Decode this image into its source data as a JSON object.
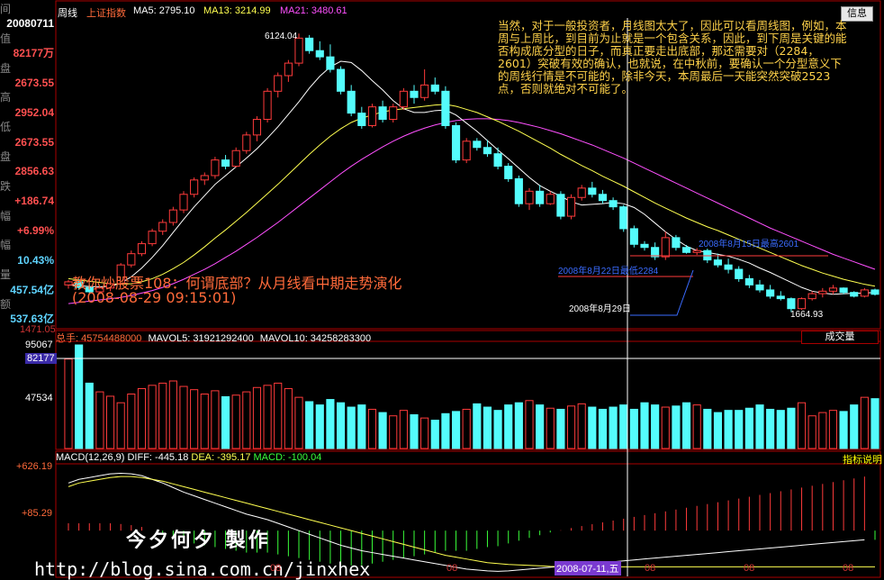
{
  "left_panel": [
    {
      "label": "间",
      "value": "",
      "color": "#ffffff"
    },
    {
      "label": "",
      "value": "20080711",
      "color": "#ffffff"
    },
    {
      "label": "值",
      "value": "",
      "color": "#ffffff"
    },
    {
      "label": "",
      "value": "82177万",
      "color": "#ff5050"
    },
    {
      "label": "盘",
      "value": "",
      "color": "#ffffff"
    },
    {
      "label": "",
      "value": "2673.55",
      "color": "#ff5050"
    },
    {
      "label": "高",
      "value": "",
      "color": "#ffffff"
    },
    {
      "label": "",
      "value": "2952.04",
      "color": "#ff5050"
    },
    {
      "label": "低",
      "value": "",
      "color": "#ffffff"
    },
    {
      "label": "",
      "value": "2673.55",
      "color": "#ff5050"
    },
    {
      "label": "盘",
      "value": "",
      "color": "#ffffff"
    },
    {
      "label": "",
      "value": "2856.63",
      "color": "#ff5050"
    },
    {
      "label": "跌",
      "value": "",
      "color": "#ffffff"
    },
    {
      "label": "",
      "value": "+186.74",
      "color": "#ff5050"
    },
    {
      "label": "幅",
      "value": "",
      "color": "#ffffff"
    },
    {
      "label": "",
      "value": "+6.99%",
      "color": "#ff5050"
    },
    {
      "label": "幅",
      "value": "",
      "color": "#ffffff"
    },
    {
      "label": "",
      "value": "10.43%",
      "color": "#5fd4ff"
    },
    {
      "label": "量",
      "value": "",
      "color": "#ffffff"
    },
    {
      "label": "",
      "value": "457.54亿",
      "color": "#5fd4ff"
    },
    {
      "label": "额",
      "value": "",
      "color": "#ffffff"
    },
    {
      "label": "",
      "value": "537.63亿",
      "color": "#5fd4ff"
    }
  ],
  "header": {
    "period": "周线",
    "index_name": "上证指数",
    "ma5": "MA5: 2795.10",
    "ma13": "MA13: 3214.99",
    "ma21": "MA21: 3480.61",
    "info_button": "信息"
  },
  "comment": "当然，对于一般投资者，月线图太大了，因此可以看周线图，例如，本周与上周比，到目前为止就是一个包含关系，因此，到下周是关键的能否构成底分型的日子，而真正要走出底部，那还需要对（2284，2601）突破有效的确认，也就说，在中秋前，要确认一个分型意义下的周线行情是不可能的，除非今天，本周最后一天能突然突破2523点，否则就绝对不可能了。",
  "overlay": {
    "title": "教你炒股票108：何谓底部？从月线看中期走势演化",
    "time": "(2008-08-29 09:15:01)"
  },
  "annotations": {
    "peak": "6124.04",
    "low": "1664.93",
    "a1": "2008年8月15日最高2601",
    "a2": "2008年8月22日最低2284",
    "a3": "2008年8月29日"
  },
  "main_axis": {
    "bottom_label": "1471.05"
  },
  "volume": {
    "header_label": "总手:",
    "header_value": "45754488000",
    "mavol5": "MAVOL5: 31921292400",
    "mavol10": "MAVOL10: 34258283300",
    "select": "成交量",
    "y_top": "95067",
    "y_highlight": "82177",
    "y_mid": "47534"
  },
  "macd": {
    "label": "MACD(12,26,9)",
    "diff": "DIFF: -445.18",
    "dea": "DEA: -395.17",
    "macd": "MACD: -100.04",
    "button": "指标说明",
    "y_top": "+626.19",
    "y_mid": "+85.29"
  },
  "x_axis": {
    "labels": [
      "08",
      "08",
      "08",
      "08",
      "08"
    ],
    "selected": "2008-07-11,五"
  },
  "watermark": "今夕何夕  製作",
  "url": "http://blog.sina.com.cn/jinxhex",
  "colors": {
    "up": "#ff3b3b",
    "down": "#54fcfc",
    "ma5": "#ffffff",
    "ma13": "#ffff50",
    "ma21": "#ff50ff",
    "bg": "#000000"
  },
  "chart_data": {
    "type": "candlestick",
    "title": "上证指数 周线",
    "ylim": [
      1471.05,
      6300
    ],
    "candles": [
      [
        2100,
        2180,
        2040,
        2150
      ],
      [
        2150,
        2190,
        2020,
        2060
      ],
      [
        2060,
        2100,
        1960,
        1990
      ],
      [
        1990,
        2080,
        1950,
        2050
      ],
      [
        2050,
        2150,
        2000,
        2120
      ],
      [
        2120,
        2450,
        2100,
        2420
      ],
      [
        2420,
        2650,
        2380,
        2600
      ],
      [
        2600,
        2800,
        2560,
        2760
      ],
      [
        2760,
        3000,
        2720,
        2960
      ],
      [
        2960,
        3150,
        2900,
        3100
      ],
      [
        3100,
        3350,
        3050,
        3300
      ],
      [
        3300,
        3600,
        3250,
        3550
      ],
      [
        3550,
        3820,
        3500,
        3780
      ],
      [
        3780,
        3900,
        3700,
        3850
      ],
      [
        3850,
        4150,
        3800,
        4100
      ],
      [
        4100,
        4180,
        3950,
        4000
      ],
      [
        4000,
        4300,
        3980,
        4250
      ],
      [
        4250,
        4550,
        4200,
        4500
      ],
      [
        4500,
        4800,
        4400,
        4750
      ],
      [
        4750,
        5250,
        4700,
        5200
      ],
      [
        5200,
        5500,
        5100,
        5450
      ],
      [
        5450,
        5700,
        5350,
        5650
      ],
      [
        5650,
        6124.04,
        5600,
        6050
      ],
      [
        6050,
        6100,
        5800,
        5850
      ],
      [
        5850,
        6000,
        5700,
        5750
      ],
      [
        5750,
        5950,
        5500,
        5550
      ],
      [
        5550,
        5600,
        5150,
        5200
      ],
      [
        5200,
        5300,
        4800,
        4850
      ],
      [
        4850,
        4950,
        4600,
        4650
      ],
      [
        4650,
        5000,
        4620,
        4950
      ],
      [
        4950,
        5050,
        4700,
        4750
      ],
      [
        4750,
        5000,
        4700,
        4950
      ],
      [
        4950,
        5250,
        4900,
        5200
      ],
      [
        5200,
        5300,
        5000,
        5100
      ],
      [
        5100,
        5550,
        5050,
        5300
      ],
      [
        5300,
        5420,
        5150,
        5200
      ],
      [
        5200,
        5280,
        4600,
        4650
      ],
      [
        4650,
        4700,
        4050,
        4100
      ],
      [
        4100,
        4450,
        4050,
        4400
      ],
      [
        4400,
        4450,
        4250,
        4300
      ],
      [
        4300,
        4420,
        4150,
        4200
      ],
      [
        4200,
        4300,
        3950,
        4000
      ],
      [
        4000,
        4050,
        3750,
        3800
      ],
      [
        3800,
        3850,
        3350,
        3400
      ],
      [
        3400,
        3650,
        3300,
        3600
      ],
      [
        3600,
        3700,
        3350,
        3400
      ],
      [
        3400,
        3600,
        3380,
        3550
      ],
      [
        3550,
        3600,
        3150,
        3200
      ],
      [
        3200,
        3550,
        3150,
        3500
      ],
      [
        3500,
        3700,
        3450,
        3650
      ],
      [
        3650,
        3750,
        3500,
        3550
      ],
      [
        3550,
        3620,
        3400,
        3450
      ],
      [
        3450,
        3500,
        3300,
        3350
      ],
      [
        3350,
        3380,
        2950,
        3000
      ],
      [
        3000,
        3050,
        2700,
        2750
      ],
      [
        2750,
        2800,
        2650,
        2700
      ],
      [
        2700,
        2780,
        2500,
        2550
      ],
      [
        2550,
        2952.04,
        2500,
        2856.63
      ],
      [
        2856.63,
        2900,
        2650,
        2700
      ],
      [
        2700,
        2740,
        2600,
        2620
      ],
      [
        2620,
        2690,
        2580,
        2650
      ],
      [
        2650,
        2680,
        2450,
        2500
      ],
      [
        2500,
        2601,
        2380,
        2420
      ],
      [
        2420,
        2520,
        2284,
        2350
      ],
      [
        2350,
        2400,
        2150,
        2200
      ],
      [
        2200,
        2260,
        2050,
        2100
      ],
      [
        2100,
        2180,
        1980,
        2020
      ],
      [
        2020,
        2100,
        1880,
        1920
      ],
      [
        1920,
        2000,
        1850,
        1880
      ],
      [
        1880,
        1900,
        1664.93,
        1720
      ],
      [
        1720,
        1900,
        1700,
        1880
      ],
      [
        1880,
        2000,
        1850,
        1960
      ],
      [
        1960,
        2050,
        1900,
        2000
      ],
      [
        2000,
        2100,
        1950,
        2050
      ],
      [
        2050,
        2060,
        1950,
        1980
      ],
      [
        1980,
        2000,
        1900,
        1920
      ],
      [
        1920,
        2050,
        1900,
        2020
      ],
      [
        2020,
        2040,
        1930,
        1950
      ]
    ],
    "ma5": [
      2100,
      2090,
      2075,
      2070,
      2075,
      2130,
      2230,
      2370,
      2540,
      2730,
      2940,
      3150,
      3350,
      3530,
      3710,
      3850,
      3990,
      4130,
      4280,
      4450,
      4630,
      4830,
      5030,
      5250,
      5440,
      5590,
      5680,
      5660,
      5530,
      5370,
      5220,
      5050,
      4920,
      4860,
      4860,
      4890,
      4900,
      4820,
      4690,
      4560,
      4410,
      4260,
      4120,
      3970,
      3820,
      3690,
      3600,
      3520,
      3430,
      3380,
      3390,
      3400,
      3420,
      3400,
      3340,
      3230,
      3090,
      2950,
      2830,
      2720,
      2650,
      2620,
      2590,
      2560,
      2510,
      2450,
      2370,
      2300,
      2220,
      2140,
      2060,
      2000,
      1970,
      1950,
      1960,
      1965,
      1970,
      1980
    ],
    "ma13": [
      2200,
      2180,
      2160,
      2140,
      2120,
      2110,
      2120,
      2150,
      2200,
      2270,
      2360,
      2460,
      2580,
      2710,
      2850,
      2980,
      3120,
      3260,
      3410,
      3560,
      3710,
      3870,
      4030,
      4190,
      4340,
      4480,
      4600,
      4700,
      4770,
      4820,
      4870,
      4900,
      4920,
      4940,
      4960,
      4980,
      4990,
      4960,
      4910,
      4860,
      4790,
      4720,
      4640,
      4560,
      4470,
      4380,
      4290,
      4190,
      4100,
      4010,
      3930,
      3840,
      3760,
      3680,
      3590,
      3500,
      3410,
      3330,
      3250,
      3170,
      3100,
      3030,
      2970,
      2900,
      2830,
      2760,
      2690,
      2620,
      2550,
      2480,
      2410,
      2350,
      2290,
      2240,
      2190,
      2150,
      2110,
      2080
    ],
    "ma21": [
      1800,
      1820,
      1840,
      1860,
      1880,
      1900,
      1930,
      1970,
      2010,
      2060,
      2120,
      2190,
      2270,
      2350,
      2440,
      2540,
      2640,
      2750,
      2860,
      2980,
      3100,
      3230,
      3360,
      3490,
      3620,
      3750,
      3880,
      4000,
      4110,
      4210,
      4310,
      4400,
      4480,
      4550,
      4610,
      4660,
      4700,
      4730,
      4750,
      4760,
      4760,
      4750,
      4730,
      4700,
      4660,
      4620,
      4570,
      4520,
      4460,
      4400,
      4340,
      4270,
      4200,
      4130,
      4050,
      3970,
      3890,
      3810,
      3730,
      3650,
      3570,
      3490,
      3410,
      3330,
      3250,
      3170,
      3090,
      3010,
      2940,
      2870,
      2800,
      2730,
      2660,
      2590,
      2530,
      2470,
      2410,
      2350
    ],
    "volume": {
      "ylim": [
        0,
        95067
      ],
      "values": [
        82177,
        95067,
        60000,
        52000,
        48000,
        42000,
        50000,
        55000,
        58000,
        60000,
        62000,
        57000,
        54000,
        50000,
        53000,
        47534,
        49000,
        52000,
        56000,
        58000,
        60000,
        55000,
        47000,
        43000,
        40000,
        45000,
        42000,
        38000,
        40000,
        36000,
        33000,
        30000,
        35000,
        31000,
        28000,
        26000,
        32000,
        34000,
        36000,
        41000,
        38000,
        35000,
        40000,
        42000,
        44000,
        40000,
        37000,
        36000,
        39000,
        41000,
        38000,
        36000,
        38000,
        40000,
        36000,
        42000,
        40000,
        38000,
        39000,
        42000,
        40000,
        36000,
        33000,
        35000,
        35000,
        37000,
        40000,
        36000,
        35000,
        37000,
        42000,
        30000,
        33000,
        35000,
        34000,
        40000,
        47000,
        45754
      ]
    },
    "macd": {
      "ylim": [
        -500,
        700
      ],
      "diff": [
        520,
        560,
        580,
        600,
        620,
        626.19,
        620,
        600,
        560,
        520,
        470,
        420,
        380,
        340,
        300,
        260,
        220,
        180,
        150,
        120,
        80,
        40,
        0,
        -40,
        -80,
        -120,
        -160,
        -190,
        -220,
        -240,
        -260,
        -280,
        -300,
        -320,
        -340,
        -360,
        -380,
        -400,
        -420,
        -430,
        -440,
        -445,
        -440,
        -430,
        -420,
        -410,
        -400,
        -390,
        -380,
        -370,
        -360,
        -350,
        -340,
        -330,
        -320,
        -310,
        -300,
        -290,
        -280,
        -270,
        -260,
        -250,
        -240,
        -230,
        -220,
        -210,
        -200,
        -190,
        -180,
        -170,
        -160,
        -150,
        -140,
        -130,
        -120,
        -110,
        -100,
        -445.18
      ],
      "dea": [
        480,
        520,
        540,
        560,
        580,
        590,
        590,
        580,
        560,
        540,
        510,
        480,
        450,
        420,
        390,
        360,
        330,
        300,
        270,
        240,
        210,
        180,
        150,
        120,
        90,
        60,
        30,
        0,
        -30,
        -60,
        -90,
        -120,
        -150,
        -180,
        -210,
        -240,
        -270,
        -290,
        -310,
        -330,
        -350,
        -360,
        -370,
        -375,
        -380,
        -385,
        -390,
        -392,
        -394,
        -395,
        -395,
        -395,
        -395,
        -395,
        -395,
        -395,
        -395,
        -395,
        -395,
        -395,
        -395,
        -395,
        -395,
        -395,
        -395,
        -395,
        -395,
        -395,
        -395,
        -395,
        -395,
        -395,
        -395,
        -395,
        -395,
        -395,
        -395,
        -395.17
      ]
    }
  }
}
